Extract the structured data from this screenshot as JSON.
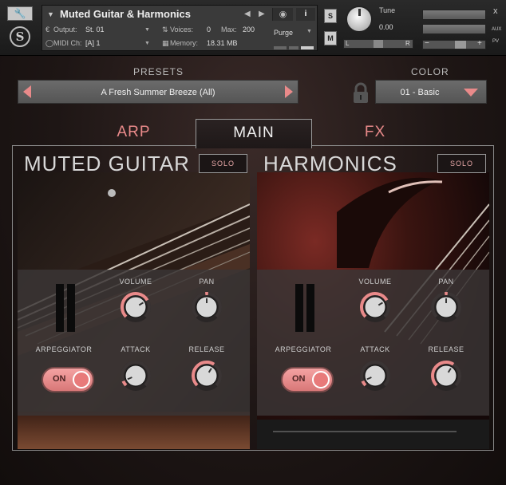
{
  "header": {
    "instrument_name": "Muted Guitar & Harmonics",
    "output_label": "Output:",
    "output_value": "St. 01",
    "voices_label": "Voices:",
    "voices_value": "0",
    "max_label": "Max:",
    "max_value": "200",
    "purge_label": "Purge",
    "midi_label": "MIDI Ch:",
    "midi_value": "[A] 1",
    "memory_label": "Memory:",
    "memory_value": "18.31 MB",
    "solo_btn": "S",
    "mute_btn": "M",
    "tune_label": "Tune",
    "tune_value": "0.00",
    "pan_left": "L",
    "pan_right": "R",
    "aux_label": "AUX",
    "pv_label": "PV",
    "close": "x",
    "minus": "−",
    "plus": "+"
  },
  "top": {
    "presets_label": "PRESETS",
    "preset_name": "A Fresh Summer Breeze (All)",
    "color_label": "COLOR",
    "color_value": "01 - Basic"
  },
  "tabs": [
    {
      "label": "ARP",
      "active": false
    },
    {
      "label": "MAIN",
      "active": true
    },
    {
      "label": "FX",
      "active": false
    }
  ],
  "panels": [
    {
      "title": "MUTED GUITAR",
      "solo": "SOLO",
      "volume_label": "VOLUME",
      "pan_label": "PAN",
      "arpeggiator_label": "ARPEGGIATOR",
      "arpeggiator_state": "ON",
      "attack_label": "ATTACK",
      "release_label": "RELEASE",
      "volume": 0.72,
      "pan": 0.5,
      "attack": 0.08,
      "release": 0.62
    },
    {
      "title": "HARMONICS",
      "solo": "SOLO",
      "volume_label": "VOLUME",
      "pan_label": "PAN",
      "arpeggiator_label": "ARPEGGIATOR",
      "arpeggiator_state": "ON",
      "attack_label": "ATTACK",
      "release_label": "RELEASE",
      "volume": 0.72,
      "pan": 0.5,
      "attack": 0.08,
      "release": 0.62
    }
  ],
  "colors": {
    "accent": "#e98a8a",
    "knob_arc": "#e98a8a"
  }
}
